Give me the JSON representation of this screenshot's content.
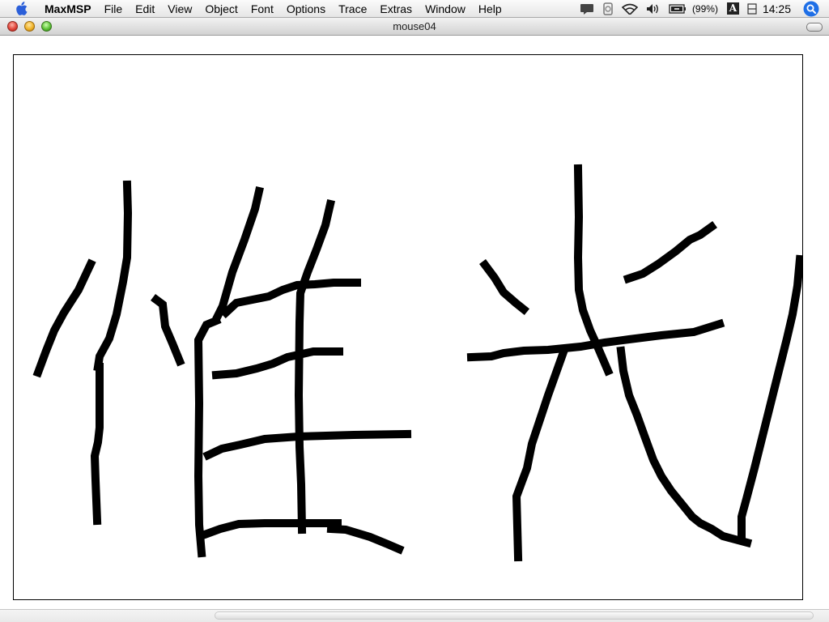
{
  "menubar": {
    "apple_icon": "apple-icon",
    "app_name": "MaxMSP",
    "menus": [
      "File",
      "Edit",
      "View",
      "Object",
      "Font",
      "Options",
      "Trace",
      "Extras",
      "Window",
      "Help"
    ],
    "tray": {
      "icons": [
        "chat-icon",
        "sync-icon",
        "wifi-icon",
        "volume-icon",
        "battery-icon",
        "input-menu-icon",
        "keyboard-icon",
        "spotlight-icon"
      ],
      "battery_percent": "(99%)",
      "input_letter": "A",
      "clock": "14:25"
    }
  },
  "window": {
    "title": "mouse04"
  },
  "colors": {
    "ink": "#000000",
    "canvas_bg": "#ffffff",
    "spotlight_blue": "#1f6fe6"
  }
}
